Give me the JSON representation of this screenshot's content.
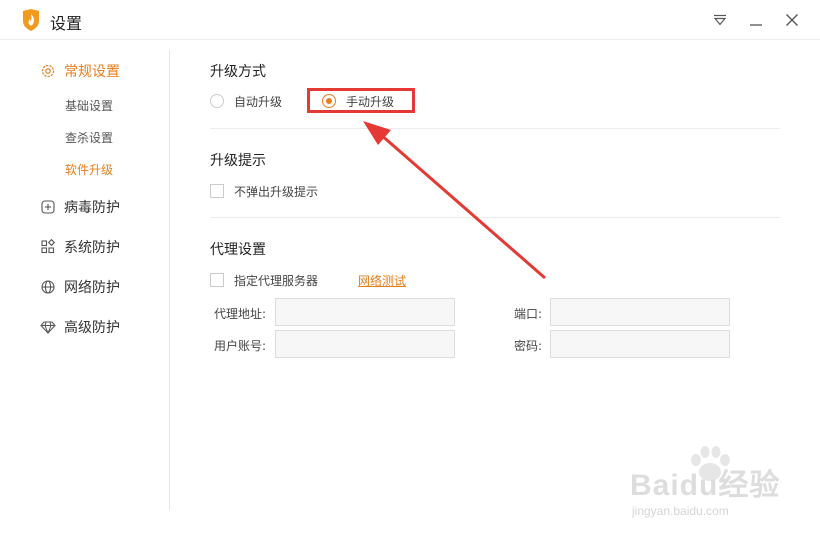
{
  "window": {
    "title": "设置",
    "brand_color": "#e87e1c"
  },
  "sidebar": {
    "groups": [
      {
        "label": "常规设置",
        "icon": "gear-icon",
        "active": true,
        "subitems": [
          {
            "label": "基础设置",
            "active": false
          },
          {
            "label": "查杀设置",
            "active": false
          },
          {
            "label": "软件升级",
            "active": true
          }
        ]
      },
      {
        "label": "病毒防护",
        "icon": "plus-square-icon",
        "active": false
      },
      {
        "label": "系统防护",
        "icon": "grid-icon",
        "active": false
      },
      {
        "label": "网络防护",
        "icon": "globe-icon",
        "active": false
      },
      {
        "label": "高级防护",
        "icon": "diamond-icon",
        "active": false
      }
    ]
  },
  "upgrade_mode": {
    "title": "升级方式",
    "options": [
      {
        "label": "自动升级",
        "checked": false
      },
      {
        "label": "手动升级",
        "checked": true
      }
    ]
  },
  "upgrade_prompt": {
    "title": "升级提示",
    "checkbox_label": "不弹出升级提示",
    "checked": false
  },
  "proxy": {
    "title": "代理设置",
    "checkbox_label": "指定代理服务器",
    "checked": false,
    "test_link": "网络测试",
    "fields": {
      "address_label": "代理地址:",
      "address_value": "",
      "port_label": "端口:",
      "port_value": "",
      "username_label": "用户账号:",
      "username_value": "",
      "password_label": "密码:",
      "password_value": ""
    }
  },
  "watermark": {
    "main": "Baidu经验",
    "sub": "jingyan.baidu.com"
  }
}
